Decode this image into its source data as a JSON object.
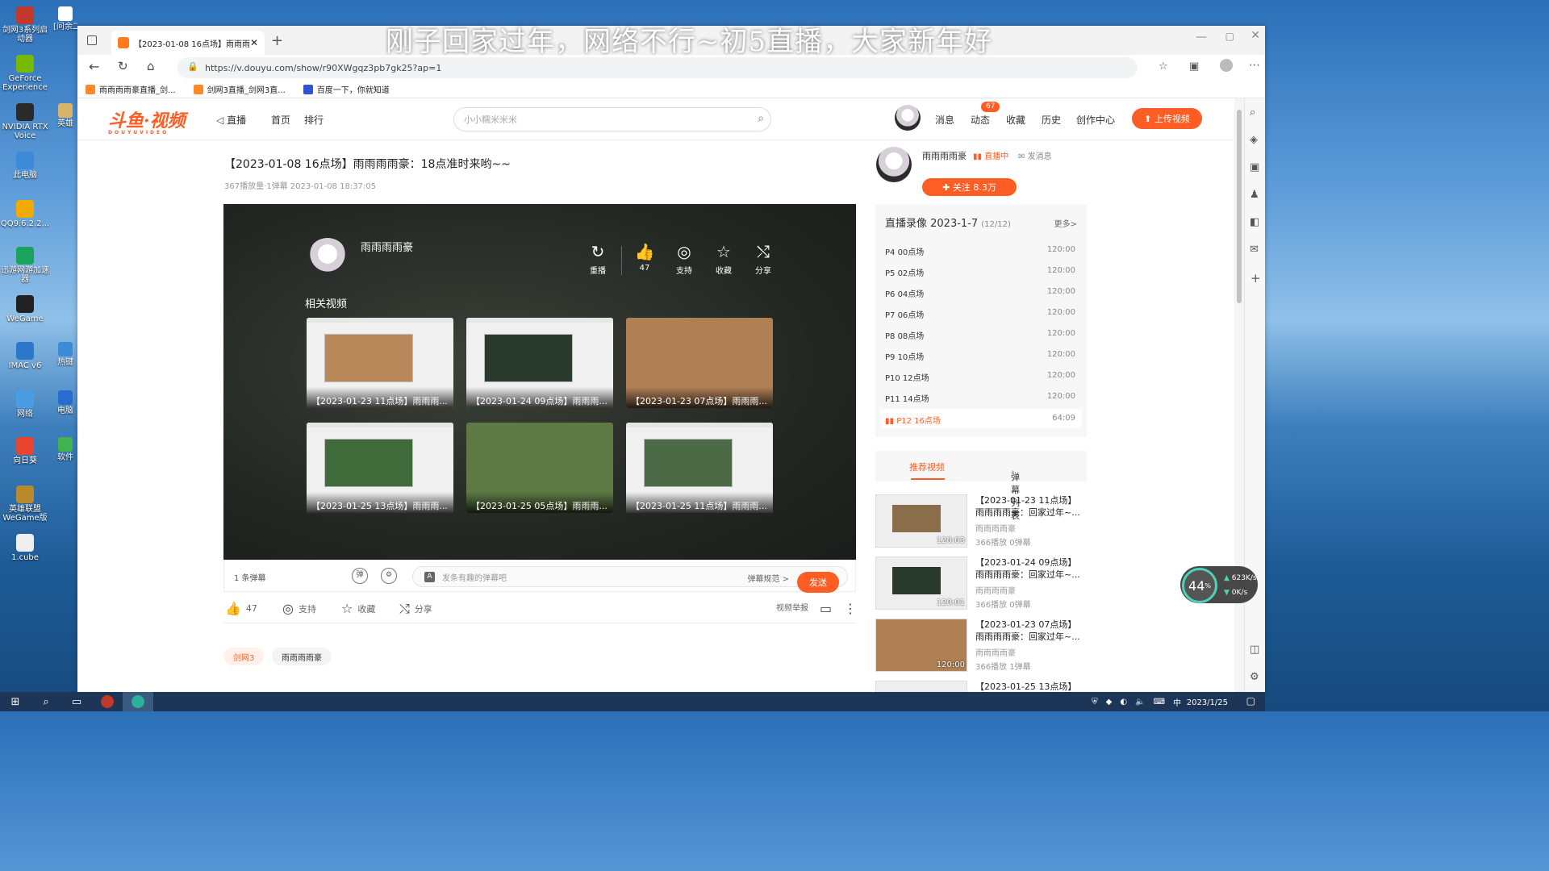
{
  "overlay_text": "刚子回家过年，网络不行~初5直播，大家新年好",
  "desktop": {
    "icons_col1": [
      "剑网3系列启动器",
      "GeForce Experience",
      "NVIDIA RTX Voice",
      "此电脑",
      "QQ9.6.2.2...",
      "迅游网游加速器",
      "WeGame",
      "IMAC v6",
      "网络",
      "向日葵",
      "英雄联盟WeGame版",
      "1.cube"
    ],
    "icons_col2": [
      "[问余二卷2...",
      "英雄",
      "热键",
      "电脑",
      "软件"
    ]
  },
  "browser": {
    "tab_title": "【2023-01-08 16点场】雨雨雨",
    "url": "https://v.douyu.com/show/r90XWgqz3pb7gk25?ap=1",
    "bookmarks": [
      "雨雨雨雨豪直播_剑...",
      "剑网3直播_剑网3直...",
      "百度一下，你就知道"
    ]
  },
  "site": {
    "logo": "斗鱼·视频",
    "logo_sub": "DOUYUVIDEO",
    "nav": [
      "直播",
      "首页",
      "排行"
    ],
    "search_placeholder": "小小糯米米米",
    "right_nav": [
      "消息",
      "动态",
      "收藏",
      "历史",
      "创作中心"
    ],
    "badge": "67",
    "upload": "上传视频"
  },
  "video": {
    "title": "【2023-01-08 16点场】雨雨雨雨豪：18点准时来哟~~",
    "meta": "367播放量·1弹幕   2023-01-08 18:37:05",
    "player_name": "雨雨雨雨豪",
    "player_actions": [
      {
        "label": "重播",
        "glyph": "↻"
      },
      {
        "label": "47",
        "glyph": "👍"
      },
      {
        "label": "支持",
        "glyph": "◎"
      },
      {
        "label": "收藏",
        "glyph": "☆"
      },
      {
        "label": "分享",
        "glyph": "⤭"
      }
    ],
    "related_title": "相关视频",
    "related": [
      "【2023-01-23 11点场】雨雨雨...",
      "【2023-01-24 09点场】雨雨雨...",
      "【2023-01-23 07点场】雨雨雨...",
      "【2023-01-25 13点场】雨雨雨...",
      "【2023-01-25 05点场】雨雨雨...",
      "【2023-01-25 11点场】雨雨雨..."
    ],
    "danmu_count": "1 条弹幕",
    "danmu_placeholder": "发条有趣的弹幕吧",
    "danmu_rule": "弹幕规范 >",
    "send": "发送",
    "like": "47",
    "support": "支持",
    "collect": "收藏",
    "share": "分享",
    "report": "视频举报",
    "tags": [
      "剑网3",
      "雨雨雨雨豪"
    ]
  },
  "uploader": {
    "name": "雨雨雨雨豪",
    "live": "直播中",
    "msg": "发消息",
    "follow": "关注  8.3万"
  },
  "records": {
    "title": "直播录像 2023-1-7",
    "count": "(12/12)",
    "more": "更多>",
    "items": [
      {
        "name": "P4 00点场",
        "dur": "120:00"
      },
      {
        "name": "P5 02点场",
        "dur": "120:00"
      },
      {
        "name": "P6 04点场",
        "dur": "120:00"
      },
      {
        "name": "P7 06点场",
        "dur": "120:00"
      },
      {
        "name": "P8 08点场",
        "dur": "120:00"
      },
      {
        "name": "P9 10点场",
        "dur": "120:00"
      },
      {
        "name": "P10 12点场",
        "dur": "120:00"
      },
      {
        "name": "P11 14点场",
        "dur": "120:00"
      },
      {
        "name": "P12 16点场",
        "dur": "64:09"
      }
    ]
  },
  "rec_tabs": {
    "a": "推荐视频",
    "b": "弹幕列表",
    "b_count": "1"
  },
  "recommend": [
    {
      "title": "【2023-01-23 11点场】雨雨雨雨豪：回家过年~...",
      "author": "雨雨雨雨豪",
      "stats": "366播放  0弹幕",
      "dur": "120:03"
    },
    {
      "title": "【2023-01-24 09点场】雨雨雨雨豪：回家过年~...",
      "author": "雨雨雨雨豪",
      "stats": "366播放  0弹幕",
      "dur": "120:01"
    },
    {
      "title": "【2023-01-23 07点场】雨雨雨雨豪：回家过年~...",
      "author": "雨雨雨雨豪",
      "stats": "366播放  1弹幕",
      "dur": "120:00"
    },
    {
      "title": "【2023-01-25 13点场】",
      "author": "",
      "stats": "",
      "dur": ""
    }
  ],
  "net": {
    "pct": "44",
    "up": "623K/s",
    "down": "0K/s",
    "pct_unit": "%"
  },
  "taskbar": {
    "date": "2023/1/25",
    "ime": "中"
  }
}
